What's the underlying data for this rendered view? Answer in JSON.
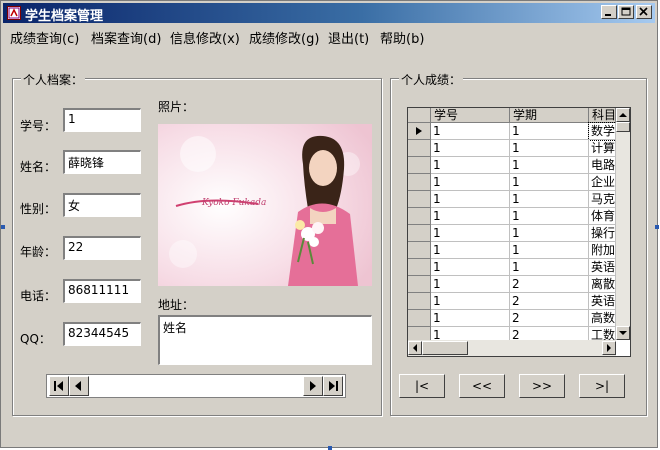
{
  "window": {
    "title": "学生档案管理"
  },
  "menu": [
    {
      "label": "成绩查询(c)"
    },
    {
      "label": "档案查询(d)"
    },
    {
      "label": "信息修改(x)"
    },
    {
      "label": "成绩修改(g)"
    },
    {
      "label": "退出(t)"
    },
    {
      "label": "帮助(b)"
    }
  ],
  "profile": {
    "group_label": "个人档案：",
    "photo_label": "照片：",
    "address_label": "地址：",
    "address_value": "姓名",
    "photo_caption": "Kyoko Fukada",
    "fields": [
      {
        "label": "学号：",
        "value": "1"
      },
      {
        "label": "姓名：",
        "value": "薛晓锋"
      },
      {
        "label": "性别：",
        "value": "女"
      },
      {
        "label": "年龄：",
        "value": "22"
      },
      {
        "label": "电话：",
        "value": "86811111"
      },
      {
        "label": "QQ：",
        "value": "82344545"
      }
    ]
  },
  "grades": {
    "group_label": "个人成绩：",
    "columns": [
      "学号",
      "学期",
      "科目"
    ],
    "rows": [
      [
        "1",
        "1",
        "数学"
      ],
      [
        "1",
        "1",
        "计算"
      ],
      [
        "1",
        "1",
        "电路"
      ],
      [
        "1",
        "1",
        "企业"
      ],
      [
        "1",
        "1",
        "马克"
      ],
      [
        "1",
        "1",
        "体育"
      ],
      [
        "1",
        "1",
        "操行"
      ],
      [
        "1",
        "1",
        "附加"
      ],
      [
        "1",
        "1",
        "英语"
      ],
      [
        "1",
        "2",
        "离散"
      ],
      [
        "1",
        "2",
        "英语"
      ],
      [
        "1",
        "2",
        "高数"
      ],
      [
        "1",
        "2",
        "工数"
      ]
    ],
    "selected_row": 0
  },
  "pager": [
    {
      "label": "|<"
    },
    {
      "label": "<<"
    },
    {
      "label": ">>"
    },
    {
      "label": ">|"
    }
  ],
  "colors": {
    "titlebar": "#0a246a",
    "face": "#d4d0c8"
  }
}
